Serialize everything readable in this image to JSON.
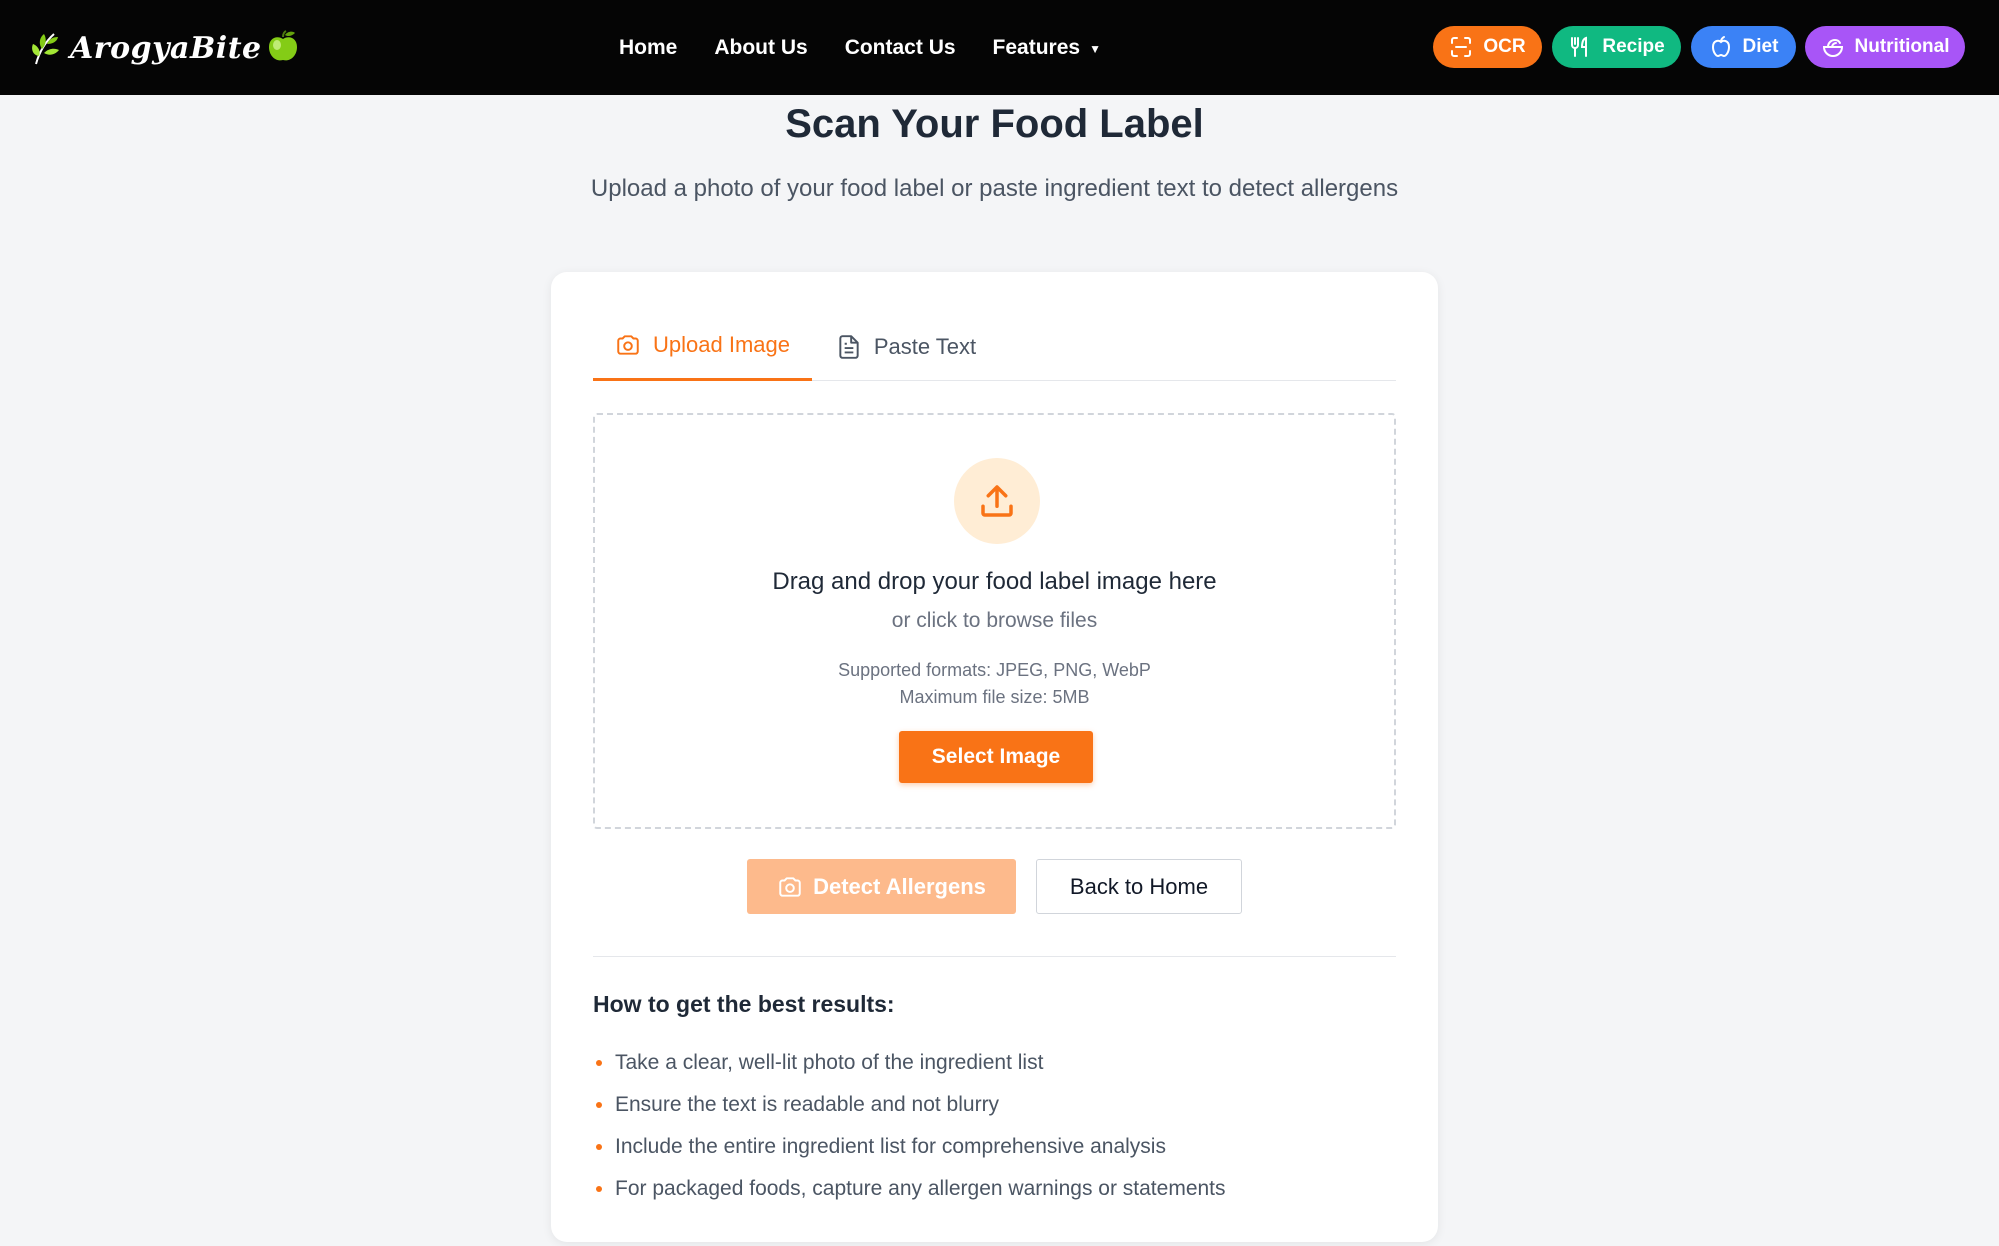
{
  "brand": {
    "name": "ArogyaBite"
  },
  "nav": {
    "links": [
      "Home",
      "About Us",
      "Contact Us"
    ],
    "features_label": "Features",
    "pills": {
      "ocr": "OCR",
      "recipe": "Recipe",
      "diet": "Diet",
      "nutritional": "Nutritional"
    }
  },
  "header": {
    "title": "Scan Your Food Label",
    "subtitle": "Upload a photo of your food label or paste ingredient text to detect allergens"
  },
  "tabs": {
    "upload": "Upload Image",
    "paste": "Paste Text",
    "active": "upload"
  },
  "dropzone": {
    "title": "Drag and drop your food label image here",
    "subtitle": "or click to browse files",
    "formats": "Supported formats: JPEG, PNG, WebP",
    "max_size": "Maximum file size: 5MB",
    "select_button": "Select Image"
  },
  "actions": {
    "detect": "Detect Allergens",
    "back": "Back to Home"
  },
  "tips": {
    "title": "How to get the best results:",
    "items": [
      "Take a clear, well-lit photo of the ingredient list",
      "Ensure the text is readable and not blurry",
      "Include the entire ingredient list for comprehensive analysis",
      "For packaged foods, capture any allergen warnings or statements"
    ]
  },
  "colors": {
    "accent": "#f97316",
    "recipe": "#10b981",
    "diet": "#3b82f6",
    "nutritional": "#a855f7",
    "navbar": "#050505",
    "background": "#f4f5f7"
  },
  "icons": {
    "brand_leaf": "leaf-icon",
    "brand_apple": "apple-icon",
    "features_caret": "caret-down-icon",
    "ocr": "scan-icon",
    "recipe": "utensils-icon",
    "diet": "apple-outline-icon",
    "nutritional": "salad-bowl-icon",
    "upload_tab": "camera-icon",
    "paste_tab": "document-icon",
    "dropzone": "upload-icon",
    "detect": "camera-icon"
  }
}
